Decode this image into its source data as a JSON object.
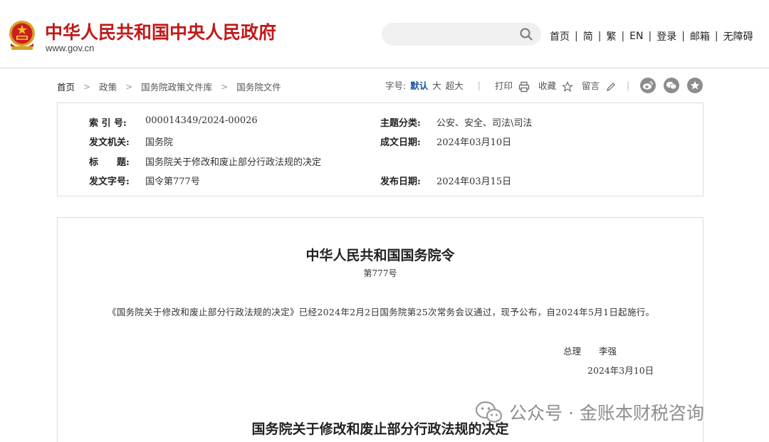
{
  "header": {
    "site_title": "中华人民共和国中央人民政府",
    "site_url": "www.gov.cn",
    "search_placeholder": "",
    "links": [
      "首页",
      "简",
      "繁",
      "EN",
      "登录",
      "邮箱",
      "无障碍"
    ]
  },
  "breadcrumb": [
    "首页",
    "政策",
    "国务院政策文件库",
    "国务院文件"
  ],
  "tools": {
    "font_label": "字号:",
    "font_sizes": [
      "默认",
      "大",
      "超大"
    ],
    "print": "打印",
    "favorite": "收藏",
    "comment": "留言"
  },
  "social_icons": [
    "weibo-icon",
    "wechat-icon",
    "star-icon"
  ],
  "info": {
    "index_no": {
      "label": "索 引 号:",
      "value": "000014349/2024-00026"
    },
    "category": {
      "label": "主题分类:",
      "value": "公安、安全、司法\\司法"
    },
    "issuer": {
      "label": "发文机关:",
      "value": "国务院"
    },
    "written_date": {
      "label": "成文日期:",
      "value": "2024年03月10日"
    },
    "title": {
      "label": "标　　题:",
      "value": "国务院关于修改和废止部分行政法规的决定"
    },
    "doc_no": {
      "label": "发文字号:",
      "value": "国令第777号"
    },
    "publish_date": {
      "label": "发布日期:",
      "value": "2024年03月15日"
    }
  },
  "document": {
    "title": "中华人民共和国国务院令",
    "number": "第777号",
    "body": "《国务院关于修改和废止部分行政法规的决定》已经2024年2月2日国务院第25次常务会议通过，现予公布，自2024年5月1日起施行。",
    "signature": "总理　　李强",
    "date": "2024年3月10日",
    "subtitle": "国务院关于修改和废止部分行政法规的决定"
  },
  "watermark": "公众号 · 金账本财税咨询",
  "colors": {
    "brand_red": "#c11a1a",
    "link_blue": "#1a5aa6",
    "border": "#dcdcdc"
  }
}
